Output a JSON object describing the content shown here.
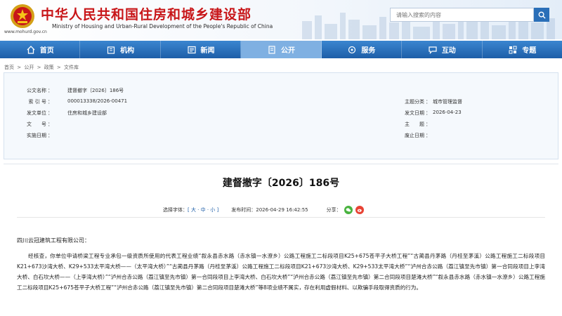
{
  "header": {
    "title": "中华人民共和国住房和城乡建设部",
    "subtitle": "Ministry of Housing and Urban-Rural Development of the People's Republic of China",
    "url": "www.mohurd.gov.cn"
  },
  "search": {
    "placeholder": "请输入搜索的内容"
  },
  "nav": {
    "items": [
      {
        "label": "首页",
        "icon": "home-icon"
      },
      {
        "label": "机构",
        "icon": "building-icon"
      },
      {
        "label": "新闻",
        "icon": "news-icon"
      },
      {
        "label": "公开",
        "icon": "document-icon",
        "active": true
      },
      {
        "label": "服务",
        "icon": "service-icon"
      },
      {
        "label": "互动",
        "icon": "chat-icon"
      },
      {
        "label": "专题",
        "icon": "topic-icon"
      }
    ]
  },
  "breadcrumb": [
    "首页",
    ">",
    "公开",
    ">",
    "政策",
    ">",
    "文件库"
  ],
  "meta": {
    "index_label": "公文名称",
    "index_value": "建督撤字〔2026〕186号",
    "serial_label": "索 引 号",
    "serial_value": "000013338/2026-00471",
    "issuer_label": "发文单位",
    "issuer_value": "住房和城乡建设部",
    "number_label": "文　　号",
    "number_value": "",
    "effective_label": "实施日期",
    "effective_value": "",
    "category_label": "主题分类",
    "category_value": "城市管理监督",
    "date_label": "发文日期",
    "date_value": "2026-04-23",
    "keywords_label": "主　　题",
    "keywords_value": "",
    "abolish_label": "废止日期",
    "abolish_value": ""
  },
  "article": {
    "title": "建督撤字〔2026〕186号",
    "font_size_label": "选择字体：",
    "font_size_options": "[ 大 · 中 · 小 ]",
    "publish_time_label": "发布时间：",
    "publish_time": "2026-04-29 16:42:55",
    "share_label": "分享：",
    "salutation": "四川云冠建筑工程有限公司：",
    "body": "经核查，你单位申请桥梁工程专业承包一级资质所使用的代表工程业绩“叙永县赤水路（赤水镇一水潦乡）公路工程施工二标段项目K25+675苍平子大桥工程”“古蔺县丹茅路（丹桂至茅溪）公路工程施工二标段项目K21+673沙湾大桥、K29+533太平湾大桥——（太平湾大桥）”“古蔺县丹茅路（丹桂至茅溪）公路工程施工二标段项目K21+673沙湾大桥、K29+533太平湾大桥”“泸州合赤公路（荔江镇至先市镇）第一合同段项目上李湾大桥、白石坎大桥——（上李湾大桥）”“泸州合赤公路（荔江镇至先市镇）第一合同段项目上李湾大桥、白石坎大桥”“泸州合赤公路（荔江镇至先市镇）第二合同段项目楚滩大桥”“叙永县赤水路（赤水镇一水潦乡）公路工程施工二标段项目K25+675苍平子大桥工程”“泸州合赤公路（荔江镇至先市镇）第二合同段项目楚滩大桥”等8项业绩不属实，存在利用虚假材料、以欺骗手段取得资质的行为。"
  },
  "colors": {
    "brand_red": "#c81619",
    "nav_blue": "#1d5ea8",
    "nav_active": "#7fb0e2",
    "meta_bg": "#f5f9fd"
  }
}
